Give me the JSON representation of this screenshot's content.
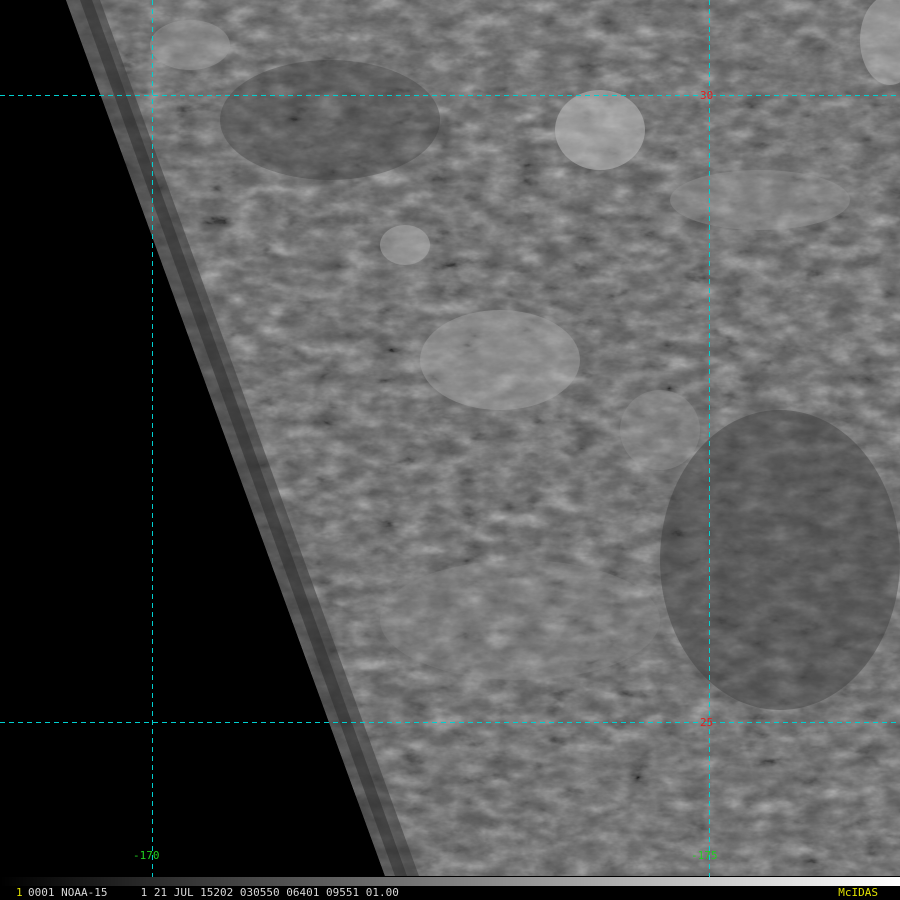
{
  "image": {
    "type": "satellite-imagery",
    "colors": {
      "background": "#000000",
      "grid": "#00d0d0",
      "lat_label": "#e02020",
      "lon_label": "#20d020",
      "frame_number": "#e0e000",
      "status_text": "#d8d8d8",
      "brand": "#e0e000"
    }
  },
  "grid": {
    "latitude_labels": [
      "30",
      "25"
    ],
    "longitude_labels": [
      "-170",
      "-175"
    ]
  },
  "status_bar": {
    "frame_number": "1",
    "text": "0001 NOAA-15     1 21 JUL 15202 030550 06401 09551 01.00",
    "brand": "McIDAS"
  }
}
